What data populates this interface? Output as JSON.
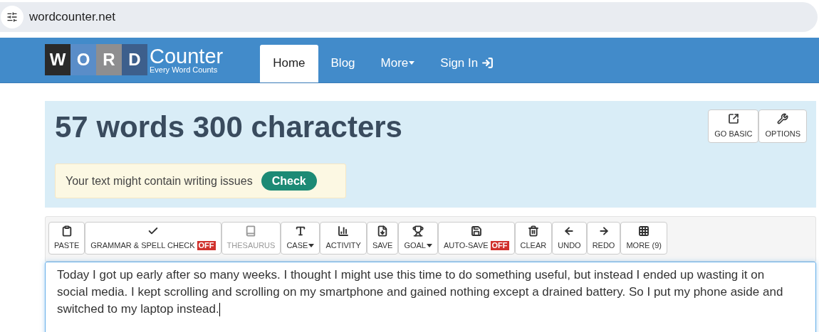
{
  "address_bar": {
    "url": "wordcounter.net"
  },
  "nav": {
    "logo": {
      "letters": [
        "W",
        "O",
        "R",
        "D"
      ],
      "name": "Counter",
      "tagline": "Every Word Counts"
    },
    "items": [
      {
        "label": "Home",
        "selected": true,
        "kind": "link"
      },
      {
        "label": "Blog",
        "selected": false,
        "kind": "link"
      },
      {
        "label": "More",
        "selected": false,
        "kind": "dropdown"
      },
      {
        "label": "Sign In",
        "selected": false,
        "kind": "signin"
      }
    ]
  },
  "stats": {
    "headline": "57 words 300 characters",
    "buttons": [
      "GO BASIC",
      "OPTIONS"
    ],
    "alert": {
      "text": "Your text might contain writing issues",
      "button": "Check"
    }
  },
  "toolbar": [
    {
      "label": "PASTE",
      "disabled": false,
      "dropdown": false
    },
    {
      "label": "GRAMMAR & SPELL CHECK",
      "badge": "OFF",
      "disabled": false,
      "dropdown": false
    },
    {
      "label": "THESAURUS",
      "disabled": true,
      "dropdown": false
    },
    {
      "label": "CASE",
      "disabled": false,
      "dropdown": true
    },
    {
      "label": "ACTIVITY",
      "disabled": false,
      "dropdown": false
    },
    {
      "label": "SAVE",
      "disabled": false,
      "dropdown": false
    },
    {
      "label": "GOAL",
      "disabled": false,
      "dropdown": true
    },
    {
      "label": "AUTO-SAVE",
      "badge": "OFF",
      "disabled": false,
      "dropdown": false
    },
    {
      "label": "CLEAR",
      "disabled": false,
      "dropdown": false
    },
    {
      "label": "UNDO",
      "disabled": false,
      "dropdown": false
    },
    {
      "label": "REDO",
      "disabled": false,
      "dropdown": false
    },
    {
      "label": "MORE (9)",
      "disabled": false,
      "dropdown": false
    }
  ],
  "editor": {
    "value": "Today I got up early after so many weeks. I thought I might use this time to do something useful, but instead I ended up wasting it on social media. I kept scrolling and scrolling on my smartphone and gained nothing except a drained battery. So I put my phone aside and switched to my laptop instead."
  }
}
